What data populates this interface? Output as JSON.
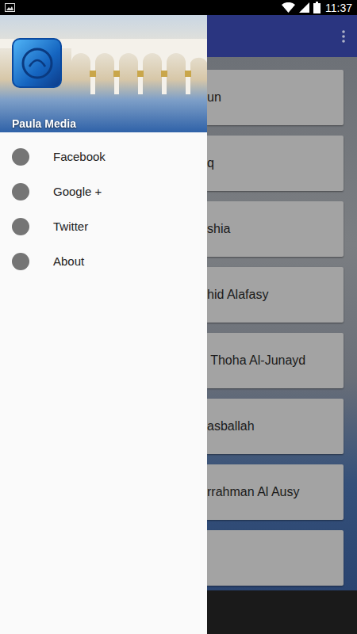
{
  "status_bar": {
    "time": "11:37"
  },
  "drawer": {
    "title": "Paula Media",
    "items": [
      {
        "label": "Facebook"
      },
      {
        "label": "Google +"
      },
      {
        "label": "Twitter"
      },
      {
        "label": "About"
      }
    ]
  },
  "list": {
    "items": [
      {
        "label": "un"
      },
      {
        "label": "q"
      },
      {
        "label": "shia"
      },
      {
        "label": "hid Alafasy"
      },
      {
        "label": " Thoha Al-Junayd"
      },
      {
        "label": "asballah"
      },
      {
        "label": "rrahman Al Ausy"
      },
      {
        "label": ""
      }
    ]
  }
}
